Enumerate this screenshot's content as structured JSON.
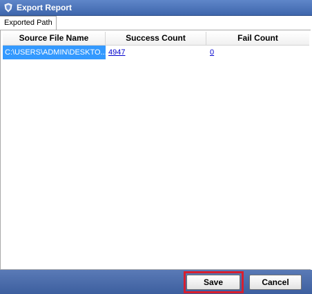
{
  "window": {
    "title": "Export Report",
    "icon": "app-shield-icon"
  },
  "tabs": [
    {
      "label": "Exported Path"
    }
  ],
  "grid": {
    "columns": [
      "Source File Name",
      "Success Count",
      "Fail Count"
    ],
    "rows": [
      {
        "source": "C:\\USERS\\ADMIN\\DESKTO...",
        "success": "4947",
        "fail": "0"
      }
    ]
  },
  "footer": {
    "save_label": "Save",
    "cancel_label": "Cancel"
  },
  "colors": {
    "titlebar": "#4a72b8",
    "selection": "#3399ff",
    "footer": "#4a6caa",
    "highlight": "#d81e2e"
  }
}
